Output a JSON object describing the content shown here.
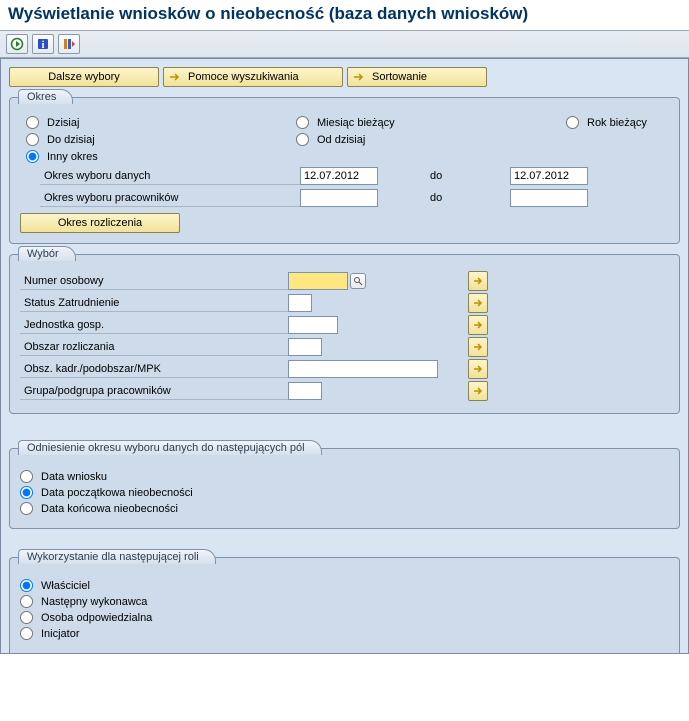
{
  "title": "Wyświetlanie wniosków o nieobecność (baza danych wniosków)",
  "top_buttons": {
    "dalsze": "Dalsze wybory",
    "pomoce": "Pomoce wyszukiwania",
    "sort": "Sortowanie"
  },
  "okres": {
    "tab": "Okres",
    "dzisiaj": "Dzisiaj",
    "miesiac": "Miesiąc bieżący",
    "rok": "Rok bieżący",
    "do_dzisiaj": "Do dzisiaj",
    "od_dzisiaj": "Od dzisiaj",
    "inny": "Inny okres",
    "okres_danych": "Okres wyboru danych",
    "okres_prac": "Okres wyboru pracowników",
    "do": "do",
    "date1_from": "12.07.2012",
    "date1_to": "12.07.2012",
    "date2_from": "",
    "date2_to": "",
    "rozlicz_btn": "Okres rozliczenia"
  },
  "wybor": {
    "tab": "Wybór",
    "numer": "Numer osobowy",
    "status": "Status Zatrudnienie",
    "jednostka": "Jednostka gosp.",
    "obszar_rozl": "Obszar rozliczania",
    "obszar_kadr": "Obsz. kadr./podobszar/MPK",
    "grupa": "Grupa/podgrupa pracowników"
  },
  "odniesienie": {
    "tab": "Odniesienie okresu wyboru danych do następujących pól",
    "data_wniosku": "Data wniosku",
    "data_pocz": "Data początkowa nieobecności",
    "data_konc": "Data końcowa nieobecności"
  },
  "rola": {
    "tab": "Wykorzystanie dla następującej roli",
    "wlasciciel": "Właściciel",
    "nastepny": "Następny wykonawca",
    "osoba": "Osoba odpowiedzialna",
    "inicjator": "Inicjator"
  }
}
